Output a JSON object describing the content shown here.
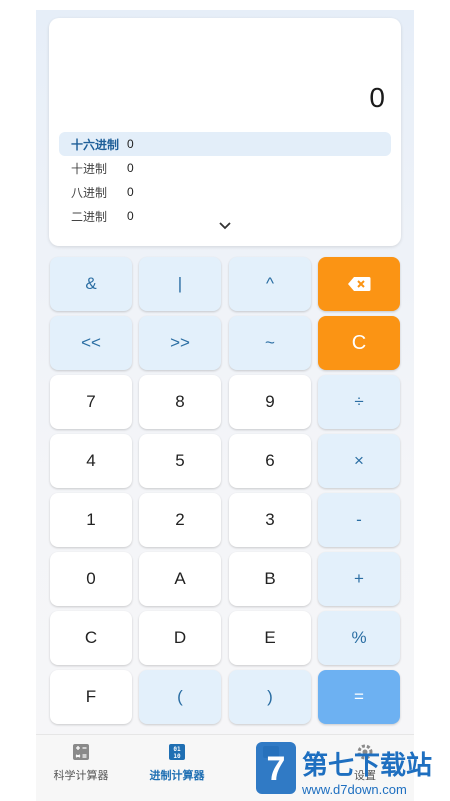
{
  "display": {
    "value": "0",
    "bases": [
      {
        "label": "十六进制",
        "value": "0",
        "active": true
      },
      {
        "label": "十进制",
        "value": "0",
        "active": false
      },
      {
        "label": "八进制",
        "value": "0",
        "active": false
      },
      {
        "label": "二进制",
        "value": "0",
        "active": false
      }
    ]
  },
  "keys": {
    "and": "&",
    "or": "|",
    "xor": "^",
    "backspace_icon": "backspace-icon",
    "shl": "<<",
    "shr": ">>",
    "not": "~",
    "clear": "C",
    "k7": "7",
    "k8": "8",
    "k9": "9",
    "div": "÷",
    "k4": "4",
    "k5": "5",
    "k6": "6",
    "mul": "×",
    "k1": "1",
    "k2": "2",
    "k3": "3",
    "sub": "-",
    "k0": "0",
    "kA": "A",
    "kB": "B",
    "add": "+",
    "kC": "C",
    "kD": "D",
    "kE": "E",
    "mod": "%",
    "kF": "F",
    "lparen": "(",
    "rparen": ")",
    "eq": "="
  },
  "nav": {
    "scientific": "科学计算器",
    "base": "进制计算器",
    "settings": "设置"
  },
  "watermark": {
    "brand": "第七下载站",
    "url": "www.d7down.com"
  },
  "colors": {
    "accent_orange": "#fb9414",
    "accent_blue": "#6db1f2",
    "light_key": "#e3f0fb",
    "active_nav": "#1f6fb3"
  }
}
